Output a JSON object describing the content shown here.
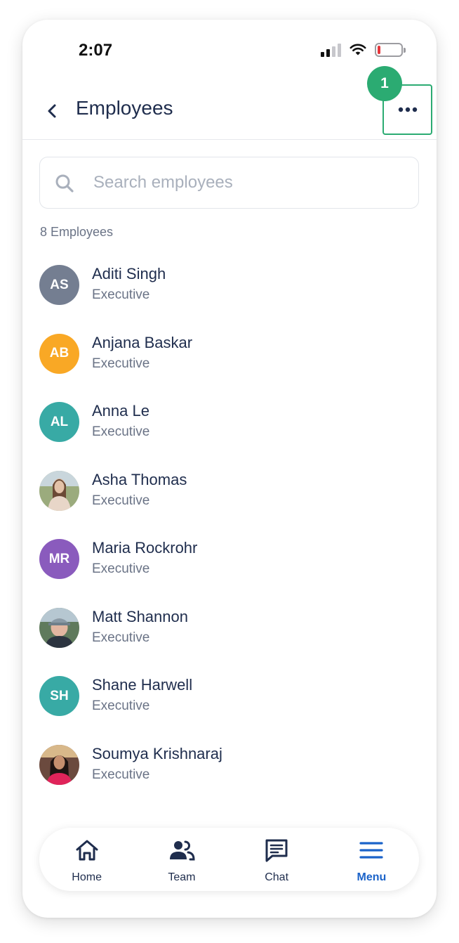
{
  "status_bar": {
    "time": "2:07"
  },
  "header": {
    "title": "Employees",
    "step_badge": "1"
  },
  "search": {
    "placeholder": "Search employees"
  },
  "employee_count": "8 Employees",
  "employees": [
    {
      "name": "Aditi Singh",
      "role": "Executive",
      "initials": "AS",
      "avatar_color": "#747e91",
      "photo": false
    },
    {
      "name": "Anjana Baskar",
      "role": "Executive",
      "initials": "AB",
      "avatar_color": "#f9a825",
      "photo": false
    },
    {
      "name": "Anna Le",
      "role": "Executive",
      "initials": "AL",
      "avatar_color": "#38aaa5",
      "photo": false
    },
    {
      "name": "Asha Thomas",
      "role": "Executive",
      "initials": "",
      "avatar_color": "#8e9a6e",
      "photo": true
    },
    {
      "name": "Maria Rockrohr",
      "role": "Executive",
      "initials": "MR",
      "avatar_color": "#8a5bbd",
      "photo": false
    },
    {
      "name": "Matt Shannon",
      "role": "Executive",
      "initials": "",
      "avatar_color": "#556b5a",
      "photo": true
    },
    {
      "name": "Shane Harwell",
      "role": "Executive",
      "initials": "SH",
      "avatar_color": "#38aaa5",
      "photo": false
    },
    {
      "name": "Soumya Krishnaraj",
      "role": "Executive",
      "initials": "",
      "avatar_color": "#5a3a36",
      "photo": true
    }
  ],
  "nav": {
    "items": [
      {
        "label": "Home",
        "icon": "home-icon"
      },
      {
        "label": "Team",
        "icon": "team-icon"
      },
      {
        "label": "Chat",
        "icon": "chat-icon"
      },
      {
        "label": "Menu",
        "icon": "menu-icon",
        "active": true
      }
    ]
  },
  "colors": {
    "accent": "#1b63c9",
    "highlight": "#2bab72",
    "text": "#1f2d4d",
    "muted": "#6a7386"
  }
}
